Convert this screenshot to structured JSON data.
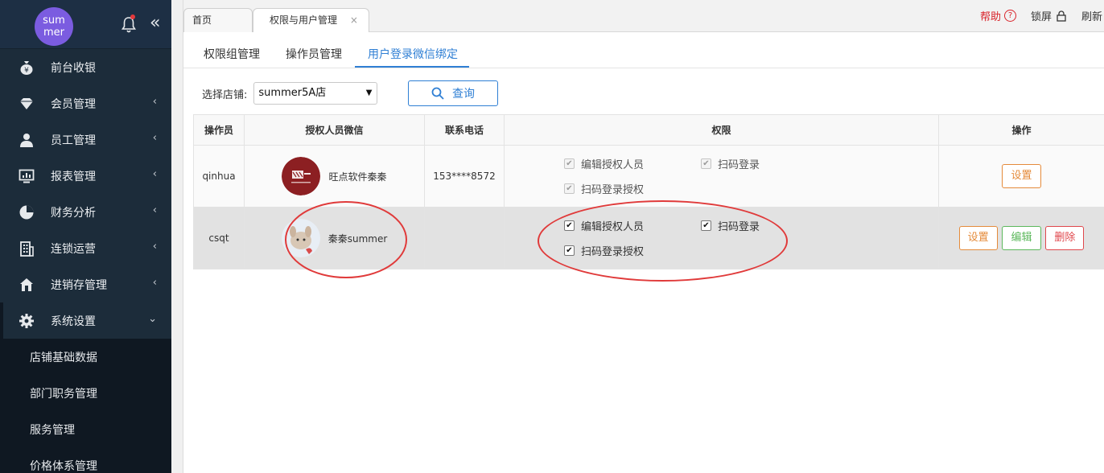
{
  "user": {
    "avatar_text": "sum mer"
  },
  "sidebar": {
    "items": [
      {
        "label": "前台收银",
        "icon": "money-bag-icon",
        "has_arrow": false
      },
      {
        "label": "会员管理",
        "icon": "diamond-icon",
        "has_arrow": true
      },
      {
        "label": "员工管理",
        "icon": "user-icon",
        "has_arrow": true
      },
      {
        "label": "报表管理",
        "icon": "monitor-chart-icon",
        "has_arrow": true
      },
      {
        "label": "财务分析",
        "icon": "pie-chart-icon",
        "has_arrow": true
      },
      {
        "label": "连锁运营",
        "icon": "building-icon",
        "has_arrow": true
      },
      {
        "label": "进销存管理",
        "icon": "house-icon",
        "has_arrow": true
      },
      {
        "label": "系统设置",
        "icon": "gear-icon",
        "has_arrow": true,
        "expanded": true
      }
    ],
    "submenu": [
      "店铺基础数据",
      "部门职务管理",
      "服务管理",
      "价格体系管理"
    ]
  },
  "tabs": {
    "home": "首页",
    "active": "权限与用户管理",
    "close": "×"
  },
  "top_tools": {
    "help": "帮助",
    "lock": "锁屏",
    "refresh": "刷新"
  },
  "subtabs": [
    "权限组管理",
    "操作员管理",
    "用户登录微信绑定"
  ],
  "filter": {
    "label": "选择店铺:",
    "store": "summer5A店",
    "query": "查询"
  },
  "table": {
    "headers": [
      "操作员",
      "授权人员微信",
      "联系电话",
      "权限",
      "操作"
    ],
    "rows": [
      {
        "operator": "qinhua",
        "wechat": "旺点软件秦秦",
        "phone": "153****8572",
        "perms": [
          "编辑授权人员",
          "扫码登录",
          "扫码登录授权"
        ],
        "actions": [
          "设置"
        ]
      },
      {
        "operator": "csqt",
        "wechat": "秦秦summer",
        "phone": "",
        "perms": [
          "编辑授权人员",
          "扫码登录",
          "扫码登录授权"
        ],
        "actions": [
          "设置",
          "编辑",
          "删除"
        ]
      }
    ]
  },
  "colors": {
    "accent": "#2f7fd4",
    "sidebar": "#1c2c3a",
    "annotation": "#e03a3a"
  }
}
